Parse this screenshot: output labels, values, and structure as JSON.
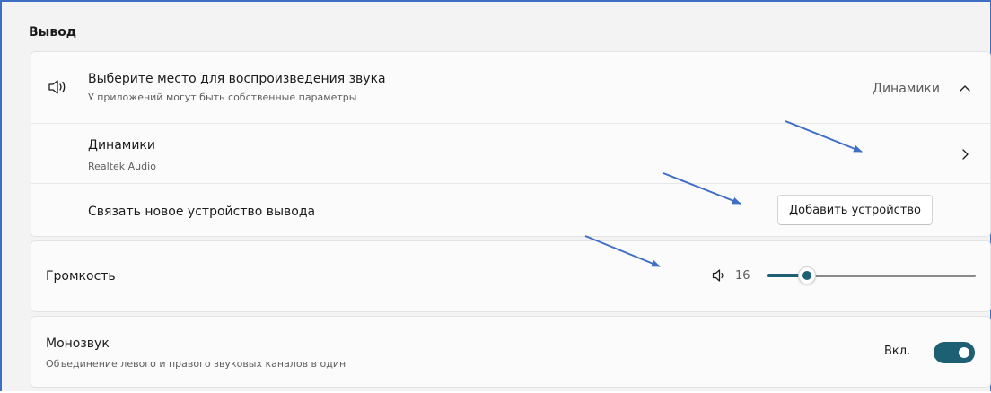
{
  "section": {
    "title": "Вывод"
  },
  "output_select": {
    "title": "Выберите место для воспроизведения звука",
    "subtitle": "У приложений могут быть собственные параметры",
    "current_device": "Динамики",
    "icon": "speaker-sound-icon",
    "expand_icon": "chevron-up-icon"
  },
  "device_item": {
    "name": "Динамики",
    "driver": "Realtek Audio",
    "icon": "chevron-right-icon"
  },
  "pair_device": {
    "label": "Связать новое устройство вывода",
    "button_label": "Добавить устройство"
  },
  "volume": {
    "label": "Громкость",
    "value": "16",
    "level_percent": 16,
    "icon": "speaker-icon"
  },
  "mono_audio": {
    "title": "Монозвук",
    "subtitle": "Объединение левого и правого звуковых каналов в один",
    "state_label": "Вкл.",
    "enabled": true
  },
  "colors": {
    "accent": "#1d5f73",
    "annotation_arrow": "#3f6fc5",
    "background": "#f3f3f3",
    "card": "#fbfbfb"
  }
}
